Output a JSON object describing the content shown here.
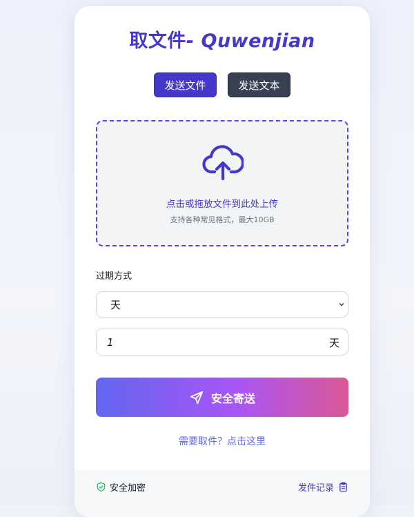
{
  "header": {
    "title_cn": "取文件",
    "title_latin": "- Quwenjian"
  },
  "modes": {
    "send_file": "发送文件",
    "send_text": "发送文本"
  },
  "dropzone": {
    "main_text": "点击或拖放文件到此处上传",
    "sub_text": "支持各种常见格式，最大10GB",
    "icon": "cloud-upload-icon"
  },
  "expiry": {
    "label": "过期方式",
    "selected": "天",
    "value": "1",
    "unit": "天"
  },
  "send_button": {
    "label": "安全寄送",
    "icon": "paper-plane-icon"
  },
  "retrieve_link": "需要取件？点击这里",
  "footer": {
    "secure_label": "安全加密",
    "secure_icon": "shield-check-icon",
    "history_label": "发件记录",
    "history_icon": "clipboard-icon"
  },
  "colors": {
    "accent": "#4338ca",
    "link": "#6366f1",
    "gradient_start": "#6366f1",
    "gradient_end": "#db5896",
    "shield": "#22c55e"
  }
}
